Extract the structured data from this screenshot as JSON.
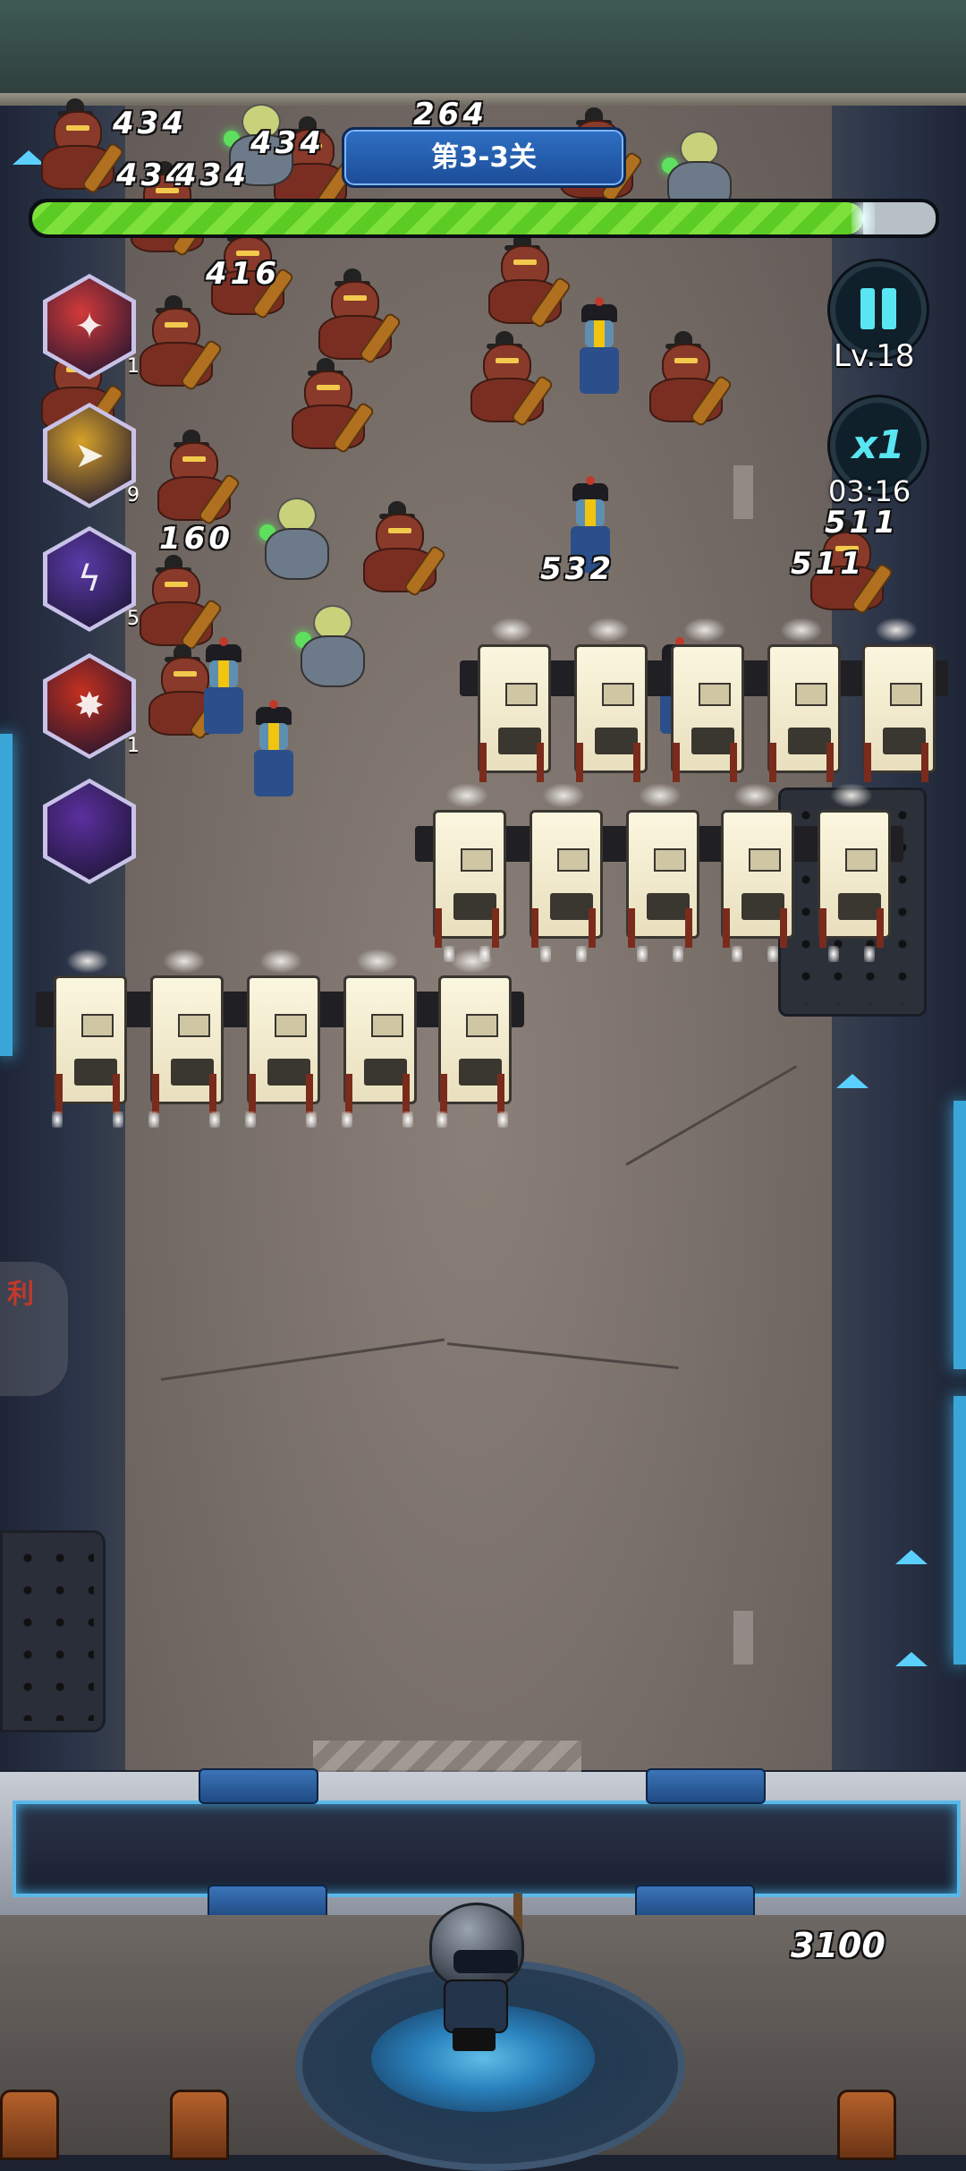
{
  "hud": {
    "stage_label": "第3-3关",
    "level_label": "Lv.18",
    "speed_label": "x1",
    "timer": "03:16",
    "wave_progress": 0.92,
    "score": "3100",
    "colors": {
      "progress_fill": "#6cd52e",
      "button_accent": "#58e6f2",
      "stage_banner": "#2a66b8"
    }
  },
  "skills": [
    {
      "name": "laser-skill-icon",
      "count": "1",
      "color": "#d23a3a"
    },
    {
      "name": "gold-boot-skill-icon",
      "count": "9",
      "color": "#d6a12a"
    },
    {
      "name": "purple-lightning-skill-icon",
      "count": "5",
      "color": "#5b3aa8"
    },
    {
      "name": "fire-slash-skill-icon",
      "count": "1",
      "color": "#c3301f"
    },
    {
      "name": "empty-skill-slot-icon",
      "count": "",
      "color": "#5b2f9e"
    }
  ],
  "damage_numbers": [
    "434",
    "434",
    "434",
    "434",
    "264",
    "416",
    "160",
    "532",
    "511",
    "511"
  ],
  "side_tab": {
    "text": "利"
  }
}
